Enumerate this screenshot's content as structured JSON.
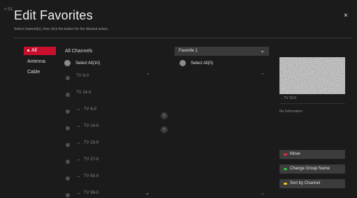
{
  "header": {
    "back_label": "< 01",
    "title": "Edit Favorites",
    "subtitle": "Select channel(s), then click the button for the desired action.",
    "close_label": "×"
  },
  "categories": [
    {
      "label": "All",
      "active": true
    },
    {
      "label": "Antenna",
      "active": false
    },
    {
      "label": "Cable",
      "active": false
    }
  ],
  "left_list": {
    "heading": "All Channels",
    "select_all": "Select All(10)",
    "channels": [
      {
        "prefix": "",
        "label": "TV  6-0"
      },
      {
        "prefix": "",
        "label": "TV  14-0"
      },
      {
        "prefix": "→",
        "label": "TV  6-0"
      },
      {
        "prefix": "→",
        "label": "TV  14-0"
      },
      {
        "prefix": "→",
        "label": "TV  23-0"
      },
      {
        "prefix": "→",
        "label": "TV  27-0"
      },
      {
        "prefix": "→",
        "label": "TV  50-0"
      },
      {
        "prefix": "→",
        "label": "TV  59-0"
      }
    ]
  },
  "right_list": {
    "group": "Favorite 1",
    "select_all": "Select All(0)"
  },
  "transfer": {
    "add_label": "›",
    "remove_label": "‹"
  },
  "preview": {
    "channel_label": "→ TV 23-0",
    "info": "No Information"
  },
  "actions": [
    {
      "label": "Move",
      "color": "#e0304a"
    },
    {
      "label": "Change Group Name",
      "color": "#35b84a"
    },
    {
      "label": "Sort by Channel",
      "color": "#e6c02a"
    }
  ],
  "icons": {
    "close": "close-icon",
    "dropdown": "chevron-down-icon",
    "scroll_up": "chevron-up-icon",
    "scroll_down": "chevron-down-icon"
  }
}
